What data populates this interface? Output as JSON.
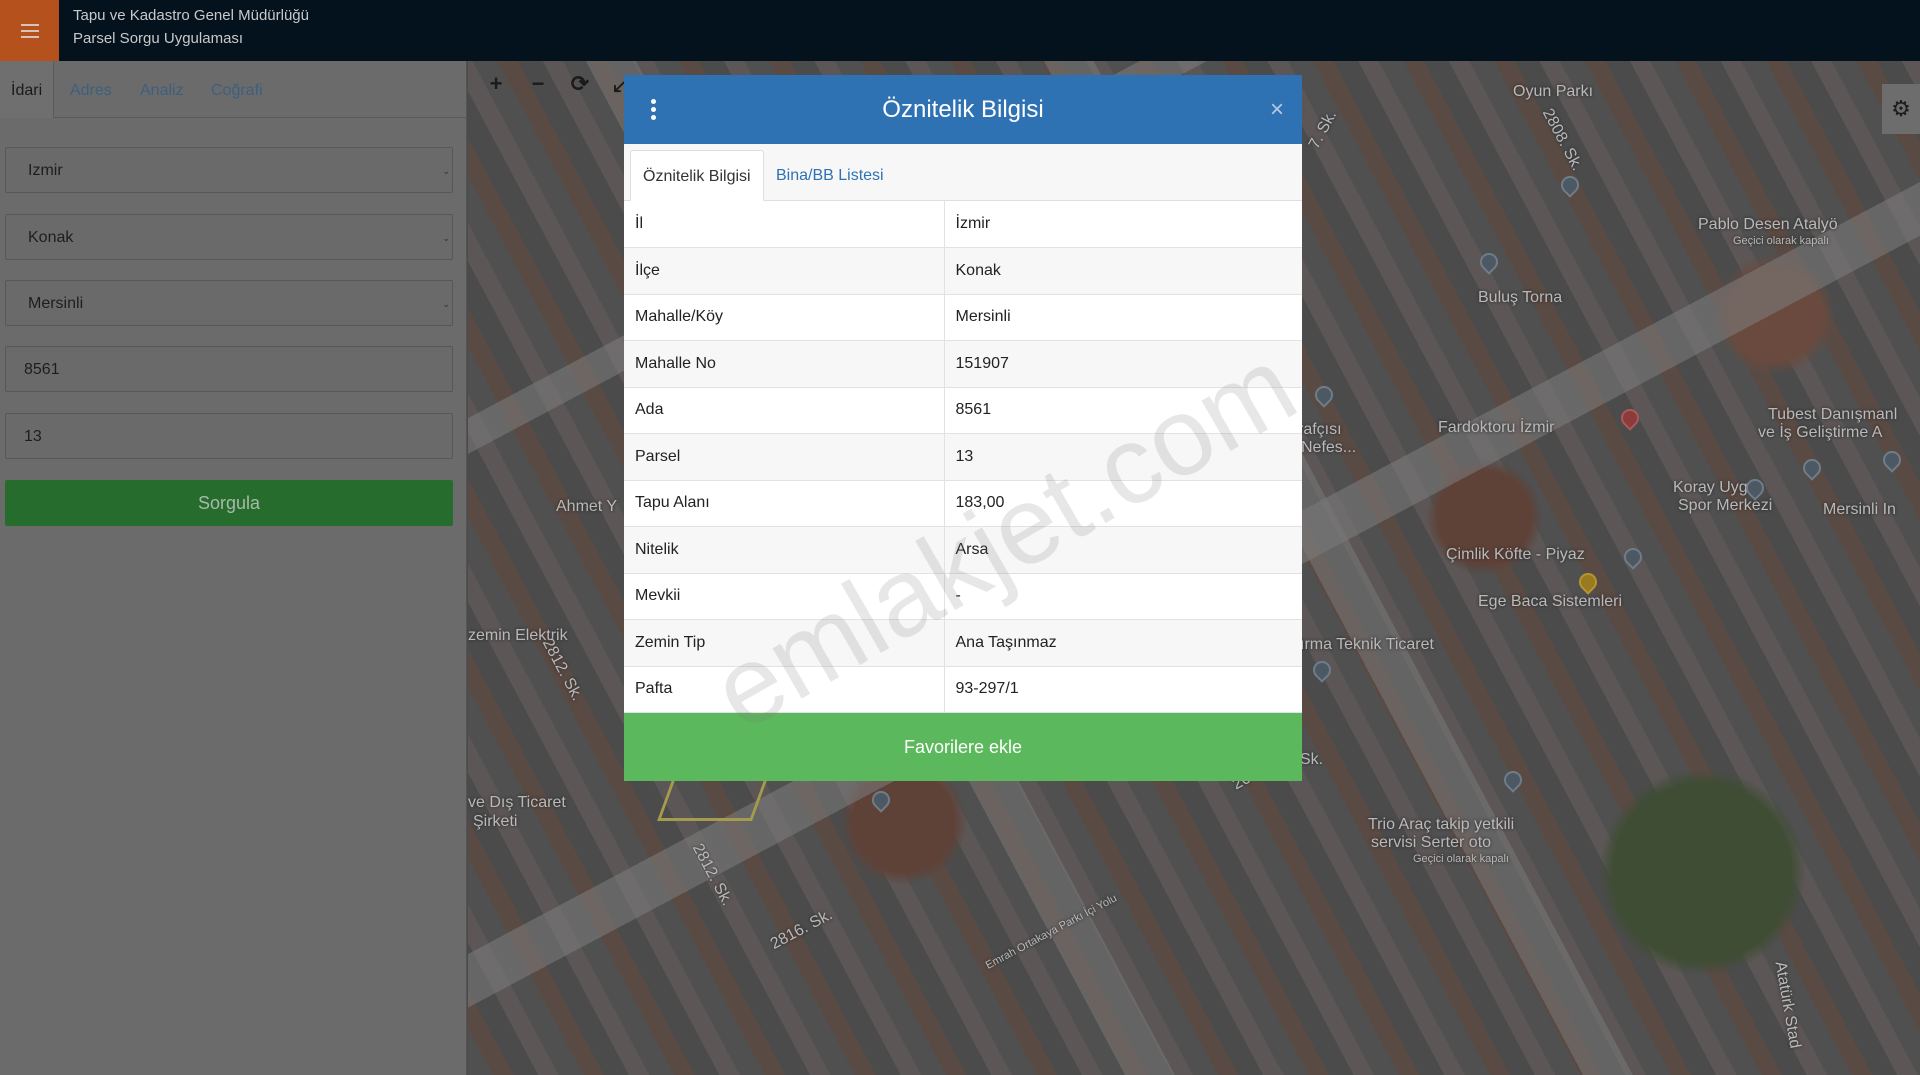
{
  "header": {
    "org_name": "Tapu ve Kadastro Genel Müdürlüğü",
    "app_name": "Parsel Sorgu Uygulaması",
    "menu_icon": "hamburger-icon",
    "menu_color": "#b4511d",
    "bar_color": "#04121e"
  },
  "sidebar": {
    "tabs": [
      "İdari",
      "Adres",
      "Analiz",
      "Coğrafi"
    ],
    "active_tab": "İdari",
    "province": "Izmir",
    "district": "Konak",
    "neighborhood": "Mersinli",
    "block_no": "8561",
    "parcel_no": "13",
    "query_label": "Sorgula",
    "query_color": "#266d2d"
  },
  "map": {
    "tools": [
      "zoom-in-icon",
      "zoom-out-icon",
      "refresh-icon",
      "fullscreen-icon"
    ],
    "settings_icon": "gear-icon",
    "labels": {
      "oyun_parki": "Oyun Parkı",
      "street_2808": "2808. Sk.",
      "street_7": "7. Sk.",
      "pablo": "Pablo Desen Atalyö",
      "temp_closed_1": "Geçici olarak kapalı",
      "bulus_torna": "Buluş Torna",
      "fardoktoru": "Fardoktoru İzmir",
      "tubest": "Tubest Danışmanl",
      "tubest2": "ve İş Geliştirme A",
      "rafcisi": "rafçısı",
      "nefes": "Nefes...",
      "koray": "Koray Uygur",
      "spor": "Spor Merkezi",
      "mersinli_in": "Mersinli In",
      "ahmet": "Ahmet Y",
      "cimlik": "Çimlik Köfte - Piyaz",
      "ege_baca": "Ege Baca Sistemleri",
      "zemin_elektrik": "zemin Elektrik",
      "street_2812a": "2812. Sk.",
      "irma": "ırma Teknik Ticaret",
      "dis_ticaret": "ve Dış Ticaret",
      "sirketi": "Şirketi",
      "street_2812b": "2812. Sk.",
      "street_2816": "2816. Sk.",
      "emrah": "Emrah Ortakaya Parkı İçi Yolu",
      "trio": "Trio Araç takip yetkili",
      "trio2": "servisi Serter oto",
      "temp_closed_2": "Geçici olarak kapalı",
      "street_sk": "Sk.",
      "street_26": "26",
      "ataturk": "Atatürk Stad"
    }
  },
  "modal": {
    "title": "Öznitelik Bilgisi",
    "menu_icon": "kebab-icon",
    "close_icon": "close-icon",
    "close_glyph": "×",
    "tabs": [
      "Öznitelik Bilgisi",
      "Bina/BB Listesi"
    ],
    "active_tab": "Öznitelik Bilgisi",
    "header_color": "#2f72b4",
    "rows": [
      {
        "key": "İl",
        "value": "İzmir"
      },
      {
        "key": "İlçe",
        "value": "Konak"
      },
      {
        "key": "Mahalle/Köy",
        "value": "Mersinli"
      },
      {
        "key": "Mahalle No",
        "value": "151907"
      },
      {
        "key": "Ada",
        "value": "8561"
      },
      {
        "key": "Parsel",
        "value": "13"
      },
      {
        "key": "Tapu Alanı",
        "value": "183,00"
      },
      {
        "key": "Nitelik",
        "value": "Arsa"
      },
      {
        "key": "Mevkii",
        "value": "-"
      },
      {
        "key": "Zemin Tip",
        "value": "Ana Taşınmaz"
      },
      {
        "key": "Pafta",
        "value": "93-297/1"
      }
    ],
    "favorite_label": "Favorilere ekle",
    "favorite_color": "#5cb85c"
  },
  "watermark": "emlakjet.com"
}
